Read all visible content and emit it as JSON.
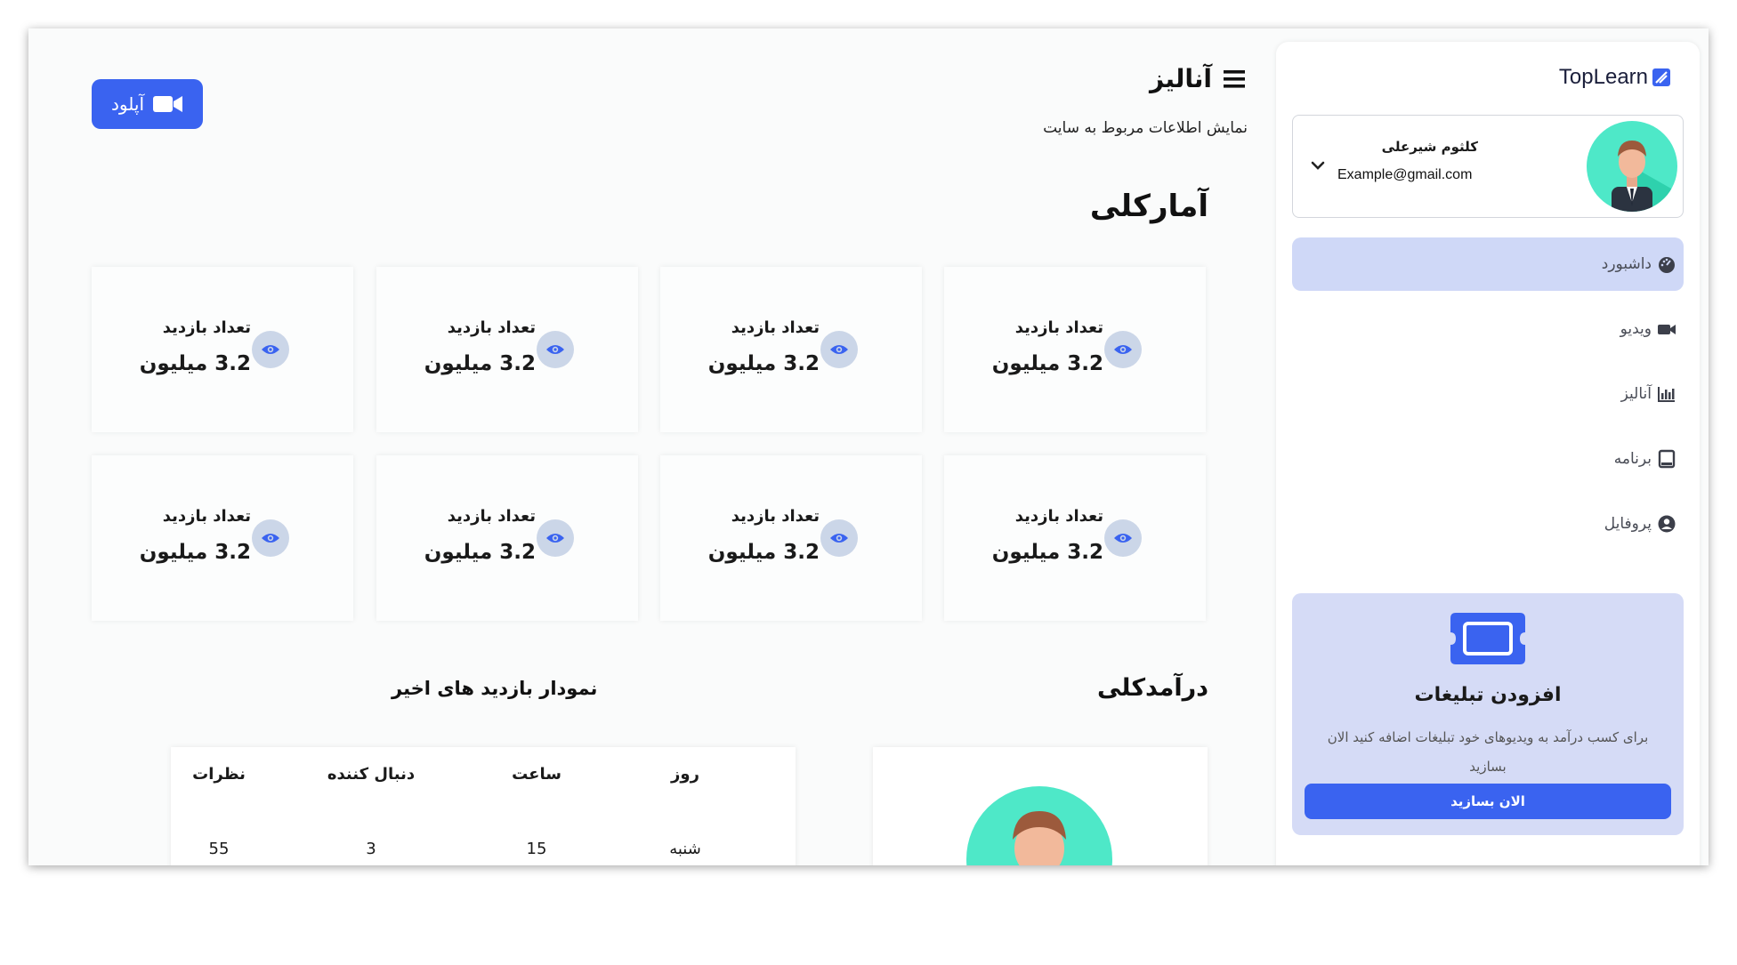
{
  "sidebar": {
    "brand": "TopLearn",
    "user": {
      "name": "کلثوم شیرعلی",
      "email": "Example@gmail.com"
    },
    "nav": [
      {
        "label": "داشبورد",
        "icon": "dashboard-gauge-icon",
        "active": true
      },
      {
        "label": "ویدیو",
        "icon": "video-camera-icon",
        "active": false
      },
      {
        "label": "آنالیز",
        "icon": "bar-chart-icon",
        "active": false
      },
      {
        "label": "برنامه",
        "icon": "tablet-icon",
        "active": false
      },
      {
        "label": "پروفایل",
        "icon": "user-circle-icon",
        "active": false
      }
    ],
    "promo": {
      "title": "افزودن تبلیغات",
      "description": "برای کسب درآمد به ویدیوهای خود تبلیغات اضافه کنید الان بسازید",
      "button": "الان بسازید"
    }
  },
  "header": {
    "title": "آنالیز",
    "subtitle": "نمایش اطلاعات مربوط به سایت",
    "upload_label": "آپلود"
  },
  "stats_section": {
    "title": "آمارکلی",
    "cards": [
      {
        "label": "تعداد بازدید",
        "value": "3.2 میلیون"
      },
      {
        "label": "تعداد بازدید",
        "value": "3.2 میلیون"
      },
      {
        "label": "تعداد بازدید",
        "value": "3.2 میلیون"
      },
      {
        "label": "تعداد بازدید",
        "value": "3.2 میلیون"
      },
      {
        "label": "تعداد بازدید",
        "value": "3.2 میلیون"
      },
      {
        "label": "تعداد بازدید",
        "value": "3.2 میلیون"
      },
      {
        "label": "تعداد بازدید",
        "value": "3.2 میلیون"
      },
      {
        "label": "تعداد بازدید",
        "value": "3.2 میلیون"
      }
    ]
  },
  "income_section": {
    "title": "درآمدکلی"
  },
  "visits_section": {
    "title": "نمودار بازدید های اخیر",
    "columns": [
      "روز",
      "ساعت",
      "دنبال کننده",
      "نظرات"
    ],
    "rows": [
      [
        "شنبه",
        "15",
        "3",
        "55"
      ]
    ]
  },
  "colors": {
    "primary": "#3a63f0",
    "active_nav_bg": "#cfd8f7",
    "promo_bg": "#d5dbf6",
    "eye_badge_bg": "#cbd6e8",
    "avatar_bg": "#4ee8c8"
  }
}
